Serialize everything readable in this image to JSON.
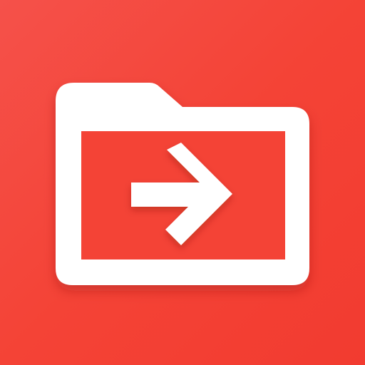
{
  "app_icon": {
    "icon_name": "folder-move-icon",
    "background_color": "#f44336",
    "folder_color": "#ffffff",
    "inner_color": "#f44336",
    "arrow_color": "#ffffff",
    "arrow_direction": "right"
  }
}
